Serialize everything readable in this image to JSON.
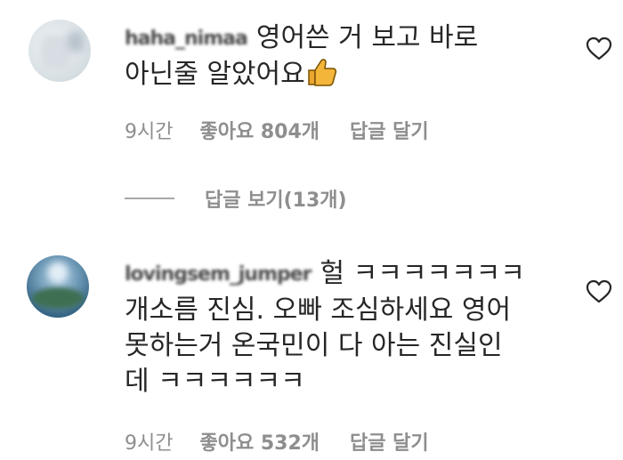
{
  "comments": [
    {
      "username": "haha_nimaa",
      "text_line1": "영어쓴 거 보고 바로",
      "text_line2": "아닌줄 알았어요",
      "emoji": "thumbs-up-icon",
      "time": "9시간",
      "likes": "좋아요 804개",
      "reply": "답글 달기",
      "view_replies": "답글 보기(13개)"
    },
    {
      "username": "lovingsem_jumper",
      "text_line1": "헐 ㅋㅋㅋㅋㅋㅋㅋ",
      "text_line2": "개소름 진심. 오빠 조심하세요 영어",
      "text_line3": "못하는거 온국민이 다 아는 진실인",
      "text_line4": "데 ㅋㅋㅋㅋㅋㅋ",
      "time": "9시간",
      "likes": "좋아요 532개",
      "reply": "답글 달기"
    }
  ],
  "colors": {
    "text": "#262626",
    "muted": "#8e8e8e",
    "emoji": "#f3b53a"
  }
}
